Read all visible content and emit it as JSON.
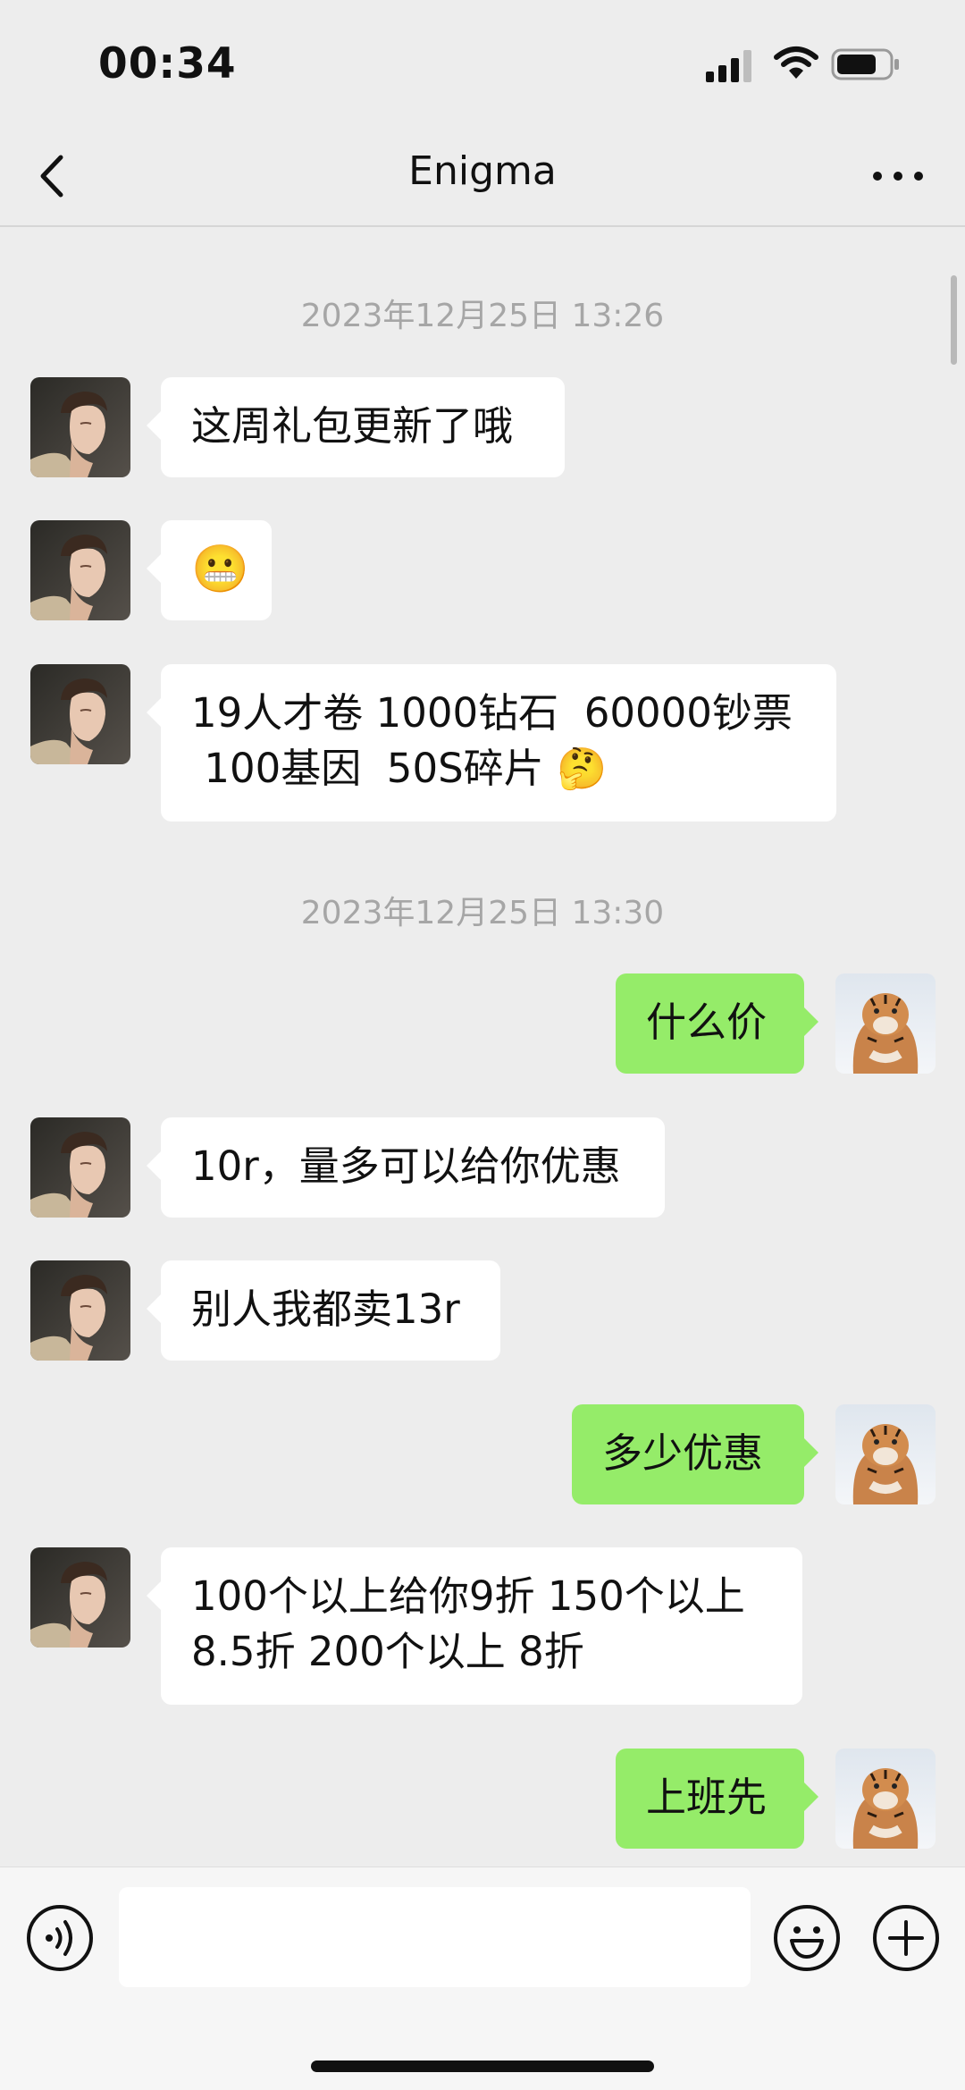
{
  "status_bar": {
    "time": "00:34"
  },
  "header": {
    "title": "Enigma"
  },
  "chat": {
    "timestamps": [
      "2023年12月25日 13:26",
      "2023年12月25日 13:30"
    ],
    "messages": [
      {
        "from": "contact",
        "text": "这周礼包更新了哦"
      },
      {
        "from": "contact",
        "text": "😬"
      },
      {
        "from": "contact",
        "text": "19人才卷 1000钻石  60000钞票\n 100基因  50S碎片 🤔"
      },
      {
        "from": "me",
        "text": "什么价"
      },
      {
        "from": "contact",
        "text": "10r，量多可以给你优惠"
      },
      {
        "from": "contact",
        "text": "别人我都卖13r"
      },
      {
        "from": "me",
        "text": "多少优惠"
      },
      {
        "from": "contact",
        "text": "100个以上给你9折 150个以上\n8.5折 200个以上 8折"
      },
      {
        "from": "me",
        "text": "上班先"
      }
    ]
  },
  "colors": {
    "background": "#ededed",
    "outgoing_bubble": "#95ec69",
    "incoming_bubble": "#ffffff",
    "timestamp": "#a6a6a6"
  },
  "icons": {
    "back": "chevron-left-icon",
    "more": "more-dots-icon",
    "voice": "voice-icon",
    "emoji": "emoji-icon",
    "plus": "plus-icon",
    "contact_avatar": "person-avatar",
    "my_avatar": "tiger-avatar"
  }
}
